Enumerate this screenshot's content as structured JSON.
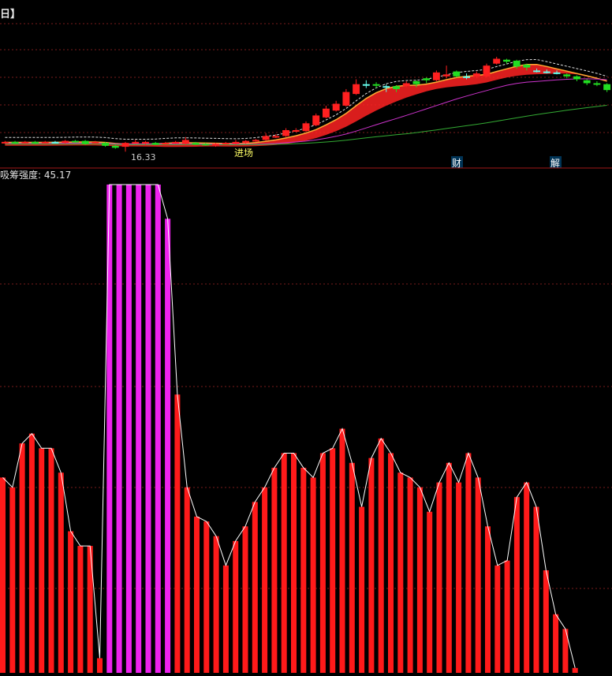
{
  "colors": {
    "background": "#000000",
    "up_bar": "#ff1a1a",
    "strong_bar": "#ee22ee",
    "line": "#ffffff",
    "grid": "#7a1c1c",
    "divider": "#a01818",
    "label": "#dddddd",
    "candle_up": "#ff2020",
    "candle_down": "#22dd22",
    "candle_doji": "#66ffee",
    "band_main": "#ff2222",
    "band_edge": "#ffaa33",
    "ma_purple": "#cc33cc",
    "ma_green": "#33aa33",
    "ma_white": "#dddddd",
    "ma_pink": "#ff88aa"
  },
  "header": {
    "title_fragment": "日】"
  },
  "price_panel": {
    "annotations": {
      "low_label": "16.33",
      "entry_label": "进场",
      "badge_cai": "财",
      "badge_jie": "解"
    }
  },
  "indicator_panel": {
    "title": "吸筹强度: 45.17"
  },
  "chart_data": [
    {
      "type": "candlestick",
      "title": "",
      "annotations": [
        "16.33",
        "进场",
        "财",
        "解"
      ],
      "candles_shape": [
        {
          "o": 0.12,
          "c": 0.13,
          "h": 0.14,
          "l": 0.11
        },
        {
          "o": 0.13,
          "c": 0.12,
          "h": 0.14,
          "l": 0.11
        },
        {
          "o": 0.12,
          "c": 0.13,
          "h": 0.14,
          "l": 0.11
        },
        {
          "o": 0.13,
          "c": 0.12,
          "h": 0.14,
          "l": 0.11
        },
        {
          "o": 0.12,
          "c": 0.13,
          "h": 0.14,
          "l": 0.11
        },
        {
          "o": 0.13,
          "c": 0.13,
          "h": 0.14,
          "l": 0.12
        },
        {
          "o": 0.12,
          "c": 0.14,
          "h": 0.15,
          "l": 0.11
        },
        {
          "o": 0.14,
          "c": 0.13,
          "h": 0.15,
          "l": 0.12
        },
        {
          "o": 0.14,
          "c": 0.11,
          "h": 0.15,
          "l": 0.1
        },
        {
          "o": 0.12,
          "c": 0.13,
          "h": 0.14,
          "l": 0.11
        },
        {
          "o": 0.12,
          "c": 0.09,
          "h": 0.13,
          "l": 0.08
        },
        {
          "o": 0.09,
          "c": 0.07,
          "h": 0.1,
          "l": 0.06
        },
        {
          "o": 0.08,
          "c": 0.12,
          "h": 0.13,
          "l": 0.03
        },
        {
          "o": 0.12,
          "c": 0.13,
          "h": 0.15,
          "l": 0.11
        },
        {
          "o": 0.12,
          "c": 0.13,
          "h": 0.14,
          "l": 0.1
        },
        {
          "o": 0.12,
          "c": 0.11,
          "h": 0.13,
          "l": 0.1
        },
        {
          "o": 0.11,
          "c": 0.12,
          "h": 0.13,
          "l": 0.1
        },
        {
          "o": 0.12,
          "c": 0.13,
          "h": 0.14,
          "l": 0.11
        },
        {
          "o": 0.11,
          "c": 0.15,
          "h": 0.18,
          "l": 0.1
        },
        {
          "o": 0.12,
          "c": 0.11,
          "h": 0.13,
          "l": 0.1
        },
        {
          "o": 0.11,
          "c": 0.1,
          "h": 0.12,
          "l": 0.09
        },
        {
          "o": 0.1,
          "c": 0.11,
          "h": 0.12,
          "l": 0.08
        },
        {
          "o": 0.11,
          "c": 0.12,
          "h": 0.13,
          "l": 0.1
        },
        {
          "o": 0.11,
          "c": 0.13,
          "h": 0.15,
          "l": 0.1
        },
        {
          "o": 0.12,
          "c": 0.14,
          "h": 0.15,
          "l": 0.11
        },
        {
          "o": 0.14,
          "c": 0.15,
          "h": 0.16,
          "l": 0.13
        },
        {
          "o": 0.15,
          "c": 0.19,
          "h": 0.22,
          "l": 0.14
        },
        {
          "o": 0.18,
          "c": 0.19,
          "h": 0.21,
          "l": 0.17
        },
        {
          "o": 0.19,
          "c": 0.25,
          "h": 0.27,
          "l": 0.18
        },
        {
          "o": 0.24,
          "c": 0.25,
          "h": 0.27,
          "l": 0.23
        },
        {
          "o": 0.24,
          "c": 0.32,
          "h": 0.34,
          "l": 0.23
        },
        {
          "o": 0.3,
          "c": 0.4,
          "h": 0.42,
          "l": 0.29
        },
        {
          "o": 0.38,
          "c": 0.47,
          "h": 0.5,
          "l": 0.37
        },
        {
          "o": 0.45,
          "c": 0.52,
          "h": 0.55,
          "l": 0.44
        },
        {
          "o": 0.5,
          "c": 0.64,
          "h": 0.67,
          "l": 0.49
        },
        {
          "o": 0.62,
          "c": 0.72,
          "h": 0.77,
          "l": 0.61
        },
        {
          "o": 0.72,
          "c": 0.72,
          "h": 0.76,
          "l": 0.68
        },
        {
          "o": 0.72,
          "c": 0.71,
          "h": 0.74,
          "l": 0.68
        },
        {
          "o": 0.7,
          "c": 0.7,
          "h": 0.72,
          "l": 0.64
        },
        {
          "o": 0.7,
          "c": 0.67,
          "h": 0.71,
          "l": 0.64
        },
        {
          "o": 0.7,
          "c": 0.73,
          "h": 0.75,
          "l": 0.69
        },
        {
          "o": 0.75,
          "c": 0.72,
          "h": 0.76,
          "l": 0.69
        },
        {
          "o": 0.78,
          "c": 0.76,
          "h": 0.79,
          "l": 0.73
        },
        {
          "o": 0.76,
          "c": 0.84,
          "h": 0.86,
          "l": 0.75
        },
        {
          "o": 0.8,
          "c": 0.82,
          "h": 0.91,
          "l": 0.78
        },
        {
          "o": 0.85,
          "c": 0.8,
          "h": 0.86,
          "l": 0.79
        },
        {
          "o": 0.8,
          "c": 0.8,
          "h": 0.83,
          "l": 0.77
        },
        {
          "o": 0.8,
          "c": 0.83,
          "h": 0.85,
          "l": 0.78
        },
        {
          "o": 0.8,
          "c": 0.91,
          "h": 0.93,
          "l": 0.79
        },
        {
          "o": 0.93,
          "c": 0.98,
          "h": 1.0,
          "l": 0.92
        },
        {
          "o": 0.97,
          "c": 0.95,
          "h": 0.98,
          "l": 0.93
        },
        {
          "o": 0.96,
          "c": 0.9,
          "h": 0.97,
          "l": 0.88
        },
        {
          "o": 0.92,
          "c": 0.89,
          "h": 0.93,
          "l": 0.86
        },
        {
          "o": 0.86,
          "c": 0.86,
          "h": 0.88,
          "l": 0.84
        },
        {
          "o": 0.85,
          "c": 0.85,
          "h": 0.87,
          "l": 0.83
        },
        {
          "o": 0.84,
          "c": 0.84,
          "h": 0.86,
          "l": 0.82
        },
        {
          "o": 0.82,
          "c": 0.8,
          "h": 0.83,
          "l": 0.78
        },
        {
          "o": 0.8,
          "c": 0.77,
          "h": 0.81,
          "l": 0.75
        },
        {
          "o": 0.76,
          "c": 0.73,
          "h": 0.77,
          "l": 0.71
        },
        {
          "o": 0.73,
          "c": 0.72,
          "h": 0.75,
          "l": 0.7
        },
        {
          "o": 0.72,
          "c": 0.66,
          "h": 0.73,
          "l": 0.64
        }
      ]
    },
    {
      "type": "bar",
      "title": "吸筹强度: 45.17",
      "xlabel": "",
      "ylabel": "",
      "ylim": [
        0,
        100
      ],
      "grid": true,
      "legend": "none",
      "series": [
        {
          "values": [
            40,
            38,
            47,
            49,
            46,
            46,
            41,
            29,
            26,
            26,
            3,
            100,
            100,
            100,
            100,
            100,
            100,
            93,
            57,
            38,
            32,
            31,
            28,
            22,
            27,
            30,
            35,
            38,
            42,
            45,
            45,
            42,
            40,
            45,
            46,
            50,
            43,
            34,
            44,
            48,
            45,
            41,
            40,
            38,
            33,
            39,
            43,
            39,
            45,
            40,
            30,
            22,
            23,
            36,
            39,
            34,
            21,
            12,
            9,
            1
          ]
        }
      ],
      "magenta_indices": [
        11,
        12,
        13,
        14,
        15,
        16,
        17
      ]
    }
  ]
}
